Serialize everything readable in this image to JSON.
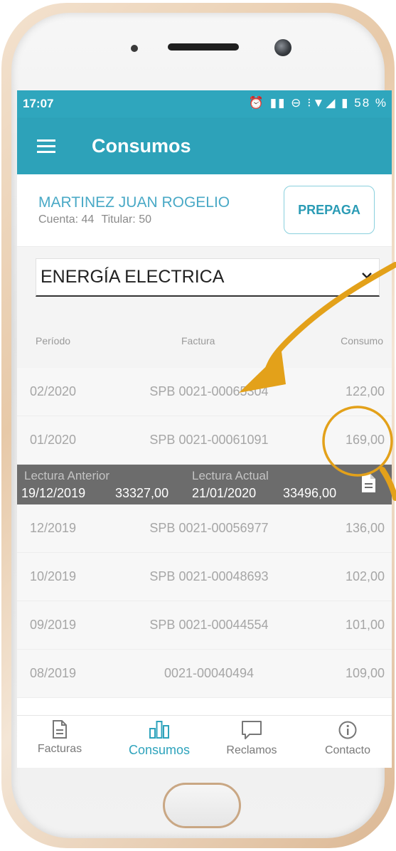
{
  "status_bar": {
    "time": "17:07",
    "icons": "⏰ ▮▮ ⊖ ⁝▼◢ ▮ 58 %"
  },
  "app_bar": {
    "title": "Consumos"
  },
  "account": {
    "name": "MARTINEZ JUAN ROGELIO",
    "account_label": "Cuenta: 44",
    "holder_label": "Titular: 50",
    "prepaga_label": "PREPAGA"
  },
  "service_selector": {
    "selected": "ENERGÍA ELECTRICA"
  },
  "table": {
    "headers": [
      "Período",
      "Factura",
      "Consumo"
    ],
    "rows": [
      {
        "period": "02/2020",
        "invoice": "SPB 0021-00065304",
        "consumption": "122,00"
      },
      {
        "period": "01/2020",
        "invoice": "SPB 0021-00061091",
        "consumption": "169,00"
      },
      {
        "period": "12/2019",
        "invoice": "SPB 0021-00056977",
        "consumption": "136,00"
      },
      {
        "period": "10/2019",
        "invoice": "SPB 0021-00048693",
        "consumption": "102,00"
      },
      {
        "period": "09/2019",
        "invoice": "SPB 0021-00044554",
        "consumption": "101,00"
      },
      {
        "period": "08/2019",
        "invoice": "0021-00040494",
        "consumption": "109,00"
      }
    ],
    "detail": {
      "prev_label": "Lectura Anterior",
      "curr_label": "Lectura Actual",
      "prev_date": "19/12/2019",
      "prev_value": "33327,00",
      "curr_date": "21/01/2020",
      "curr_value": "33496,00"
    }
  },
  "bottom_nav": {
    "items": [
      {
        "label": "Facturas"
      },
      {
        "label": "Consumos"
      },
      {
        "label": "Reclamos"
      },
      {
        "label": "Contacto"
      }
    ]
  },
  "colors": {
    "primary": "#2da2b9",
    "accent_annotation": "#e3a11a"
  }
}
